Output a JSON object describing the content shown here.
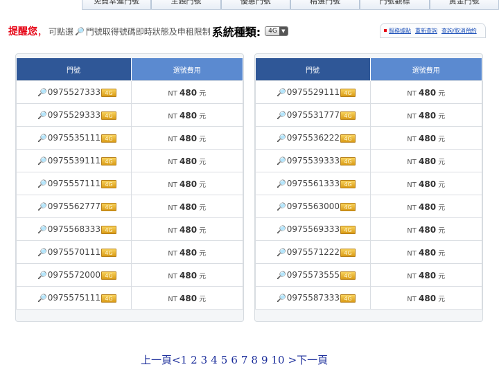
{
  "tabs": [
    "免費幸運門號",
    "主題門號",
    "優惠門號",
    "精選門號",
    "門號觀標",
    "黃金門號"
  ],
  "notice": {
    "warn": "提醒您",
    "comma": "，",
    "hint_prefix": "可點選",
    "hint_icon": "magnifier-icon",
    "hint_suffix": "門號取得號碼即時狀態及申租限制",
    "system_type_label": "系統種類:",
    "system_type_value": "4G"
  },
  "links": [
    "服務據點",
    "重新查詢",
    "查詢/取消預約"
  ],
  "table_headers": {
    "number": "門號",
    "fee": "選號費用"
  },
  "fee": {
    "prefix": "NT",
    "amount": "480",
    "unit": "元"
  },
  "badge_label": "4G",
  "left_numbers": [
    "0975527333",
    "0975529333",
    "0975535111",
    "0975539111",
    "0975557111",
    "0975562777",
    "0975568333",
    "0975570111",
    "0975572000",
    "0975575111"
  ],
  "right_numbers": [
    "0975529111",
    "0975531777",
    "0975536222",
    "0975539333",
    "0975561333",
    "0975563000",
    "0975569333",
    "0975571222",
    "0975573555",
    "0975587333"
  ],
  "pagination": {
    "prev": "上一頁<",
    "pages": [
      "1",
      "2",
      "3",
      "4",
      "5",
      "6",
      "7",
      "8",
      "9",
      "10"
    ],
    "next": ">下一頁"
  }
}
